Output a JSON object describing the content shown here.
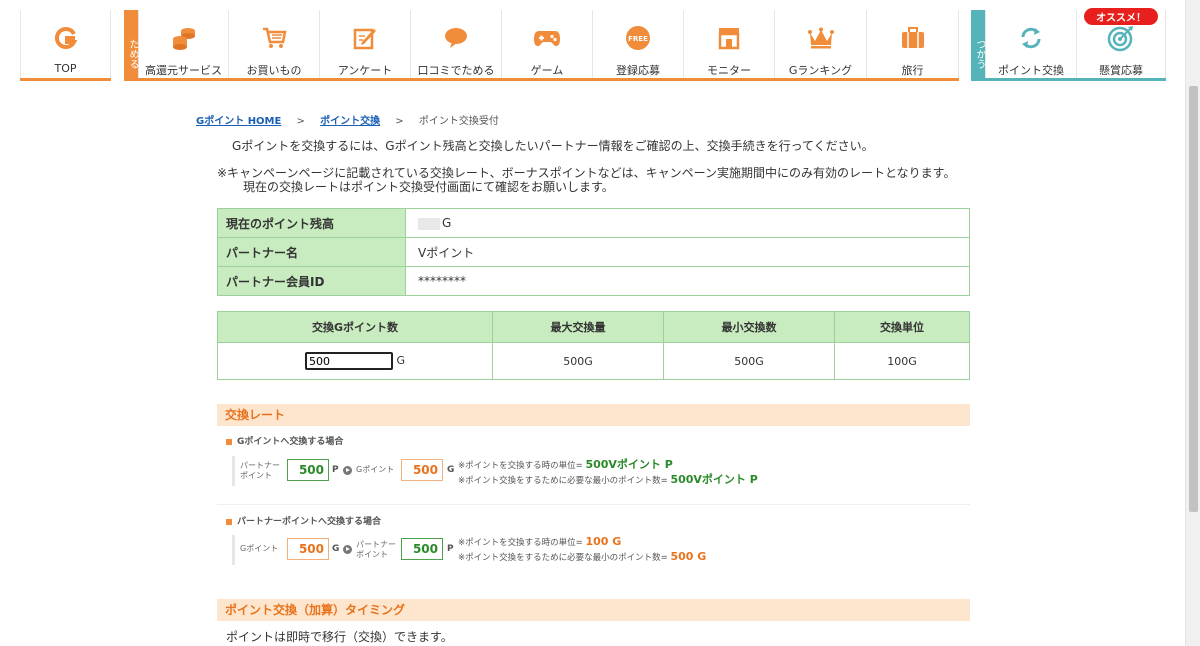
{
  "nav": {
    "top_label": "TOP",
    "tameru_tab": "ためる",
    "tsukau_tab": "つかう",
    "tameru_items": [
      {
        "label": "高還元サービス",
        "icon": "coins-icon"
      },
      {
        "label": "お買いもの",
        "icon": "shopping-cart-icon"
      },
      {
        "label": "アンケート",
        "icon": "survey-pencil-icon"
      },
      {
        "label": "口コミでためる",
        "icon": "speech-bubble-icon"
      },
      {
        "label": "ゲーム",
        "icon": "gamepad-icon"
      },
      {
        "label": "登録応募",
        "icon": "free-badge-icon"
      },
      {
        "label": "モニター",
        "icon": "store-icon"
      },
      {
        "label": "Gランキング",
        "icon": "crown-icon"
      },
      {
        "label": "旅行",
        "icon": "suitcase-icon"
      }
    ],
    "tsukau_items": [
      {
        "label": "ポイント交換",
        "icon": "exchange-arrows-icon"
      },
      {
        "label": "懸賞応募",
        "icon": "target-icon"
      }
    ],
    "recommend_badge": "オススメ！",
    "free_text": "FREE",
    "accent_orange": "#f08c3a",
    "accent_teal": "#55b4ba"
  },
  "breadcrumb": {
    "home": "Gポイント HOME",
    "exchange": "ポイント交換",
    "current": "ポイント交換受付",
    "sep": ">"
  },
  "intro": "Gポイントを交換するには、Gポイント残高と交換したいパートナー情報をご確認の上、交換手続きを行ってください。",
  "notice_line1": "※キャンペーンページに記載されている交換レート、ボーナスポイントなどは、キャンペーン実施期間中にのみ有効のレートとなります。",
  "notice_line2": "現在の交換レートはポイント交換受付画面にて確認をお願いします。",
  "info_table": {
    "balance_label": "現在のポイント残高",
    "balance_unit": "G",
    "partner_label": "パートナー名",
    "partner_value": "Vポイント",
    "member_label": "パートナー会員ID",
    "member_value": "********"
  },
  "exchange_table": {
    "headers": [
      "交換Gポイント数",
      "最大交換量",
      "最小交換数",
      "交換単位"
    ],
    "input_value": "500",
    "input_unit": "G",
    "max": "500G",
    "min": "500G",
    "unit": "100G"
  },
  "rate_section": {
    "title": "交換レート",
    "to_g": {
      "subtitle": "Gポイントへ交換する場合",
      "from_label_1": "パートナー",
      "from_label_2": "ポイント",
      "from_value": "500",
      "from_unit": "P",
      "to_label": "Gポイント",
      "to_value": "500",
      "to_unit": "G",
      "note1_text": "※ポイントを交換する時の単位=",
      "note1_value": "500Vポイント P",
      "note2_text": "※ポイント交換をするために必要な最小のポイント数=",
      "note2_value": "500Vポイント P"
    },
    "to_partner": {
      "subtitle": "パートナーポイントへ交換する場合",
      "from_label": "Gポイント",
      "from_value": "500",
      "from_unit": "G",
      "to_label_1": "パートナー",
      "to_label_2": "ポイント",
      "to_value": "500",
      "to_unit": "P",
      "note1_text": "※ポイントを交換する時の単位=",
      "note1_value": "100 G",
      "note2_text": "※ポイント交換をするために必要な最小のポイント数=",
      "note2_value": "500 G"
    }
  },
  "timing_section": {
    "title": "ポイント交換（加算）タイミング",
    "text": "ポイントは即時で移行（交換）できます。"
  }
}
